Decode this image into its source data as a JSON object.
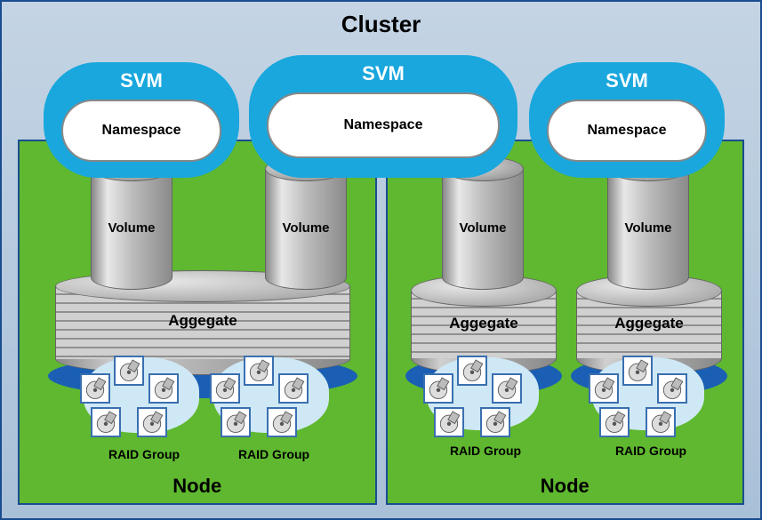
{
  "cluster": {
    "title": "Cluster"
  },
  "svm": {
    "label": "SVM",
    "namespace_label": "Namespace"
  },
  "volume": {
    "label": "Volume"
  },
  "aggregate": {
    "label": "Aggegate"
  },
  "raid": {
    "label": "RAID Group"
  },
  "node": {
    "label": "Node"
  }
}
